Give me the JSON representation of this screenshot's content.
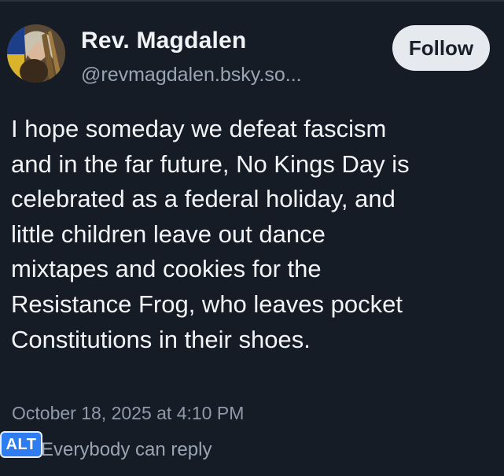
{
  "post": {
    "author": {
      "display_name": "Rev. Magdalen",
      "handle": "@revmagdalen.bsky.so..."
    },
    "follow_label": "Follow",
    "text": "I hope someday we defeat fascism\nand in the far future, No Kings Day is\ncelebrated as a federal holiday, and\nlittle children leave out dance\nmixtapes and cookies for the\nResistance Frog, who leaves pocket\nConstitutions in their shoes.",
    "timestamp": "October 18, 2025 at 4:10 PM",
    "reply_setting": "Everybody can reply"
  },
  "alt_badge": "ALT",
  "colors": {
    "background": "#161c26",
    "text_primary": "#f2f4f7",
    "text_secondary": "#9aa5b4",
    "follow_button_bg": "#e6e9ee",
    "alt_badge_bg": "#2e7df0"
  }
}
